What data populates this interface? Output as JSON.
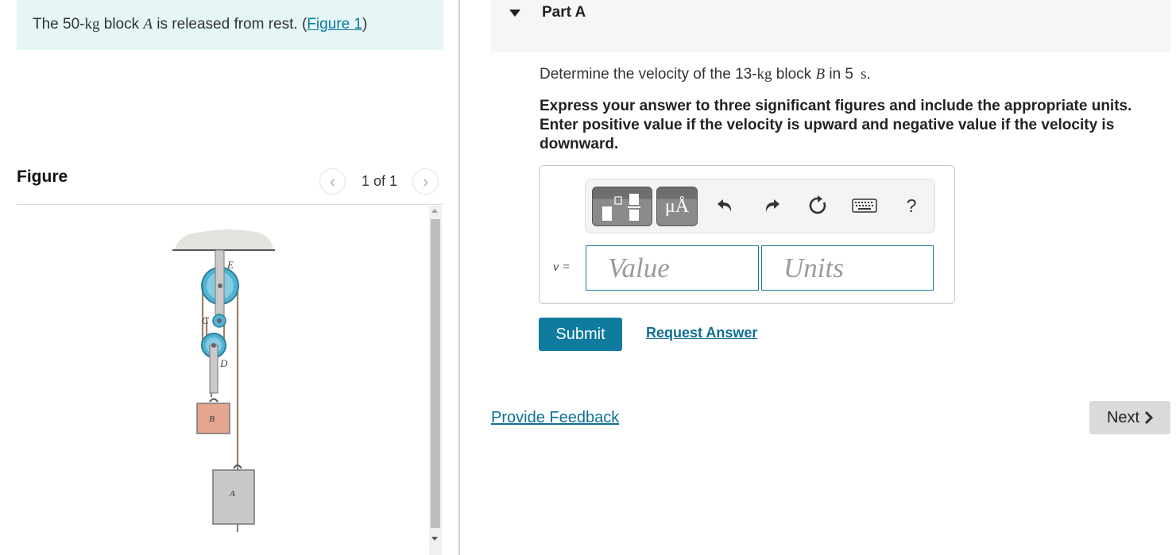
{
  "intro": {
    "prefix": "The 50-",
    "unit": "kg",
    "middle": " block ",
    "var": "A",
    "suffix": " is released from rest. (",
    "figure_link": "Figure 1",
    "close": ")"
  },
  "figure": {
    "title": "Figure",
    "pager": "1 of 1",
    "prev_icon": "chevron-left",
    "next_icon": "chevron-right",
    "labels": {
      "E": "E",
      "C": "C",
      "D": "D",
      "B": "B",
      "A": "A"
    },
    "colors": {
      "pulley": "#4fb3d4",
      "block_B": "#e6a58f",
      "block_A": "#c8c8c8",
      "rope": "#9a8266"
    }
  },
  "part": {
    "title": "Part A",
    "question_prefix": "Determine the velocity of the 13-",
    "question_unit": "kg",
    "question_middle": " block ",
    "question_var": "B",
    "question_in": " in 5 ",
    "question_time_unit": "s",
    "question_end": ".",
    "instructions": "Express your answer to three significant figures and include the appropriate units. Enter positive value if the velocity is upward and negative value if the velocity is downward."
  },
  "toolbar": {
    "symbols_label": "μÅ",
    "undo": "undo",
    "redo": "redo",
    "reset": "reset",
    "keyboard": "keyboard",
    "help": "?"
  },
  "answer": {
    "var_label": "v =",
    "value_placeholder": "Value",
    "units_placeholder": "Units",
    "value": "",
    "units": ""
  },
  "actions": {
    "submit": "Submit",
    "request_answer": "Request Answer",
    "provide_feedback": "Provide Feedback",
    "next": "Next"
  },
  "colors": {
    "intro_bg": "#e6f5f6",
    "accent": "#0f7b9e",
    "link": "#0f6f93",
    "next_bg": "#dadada"
  }
}
